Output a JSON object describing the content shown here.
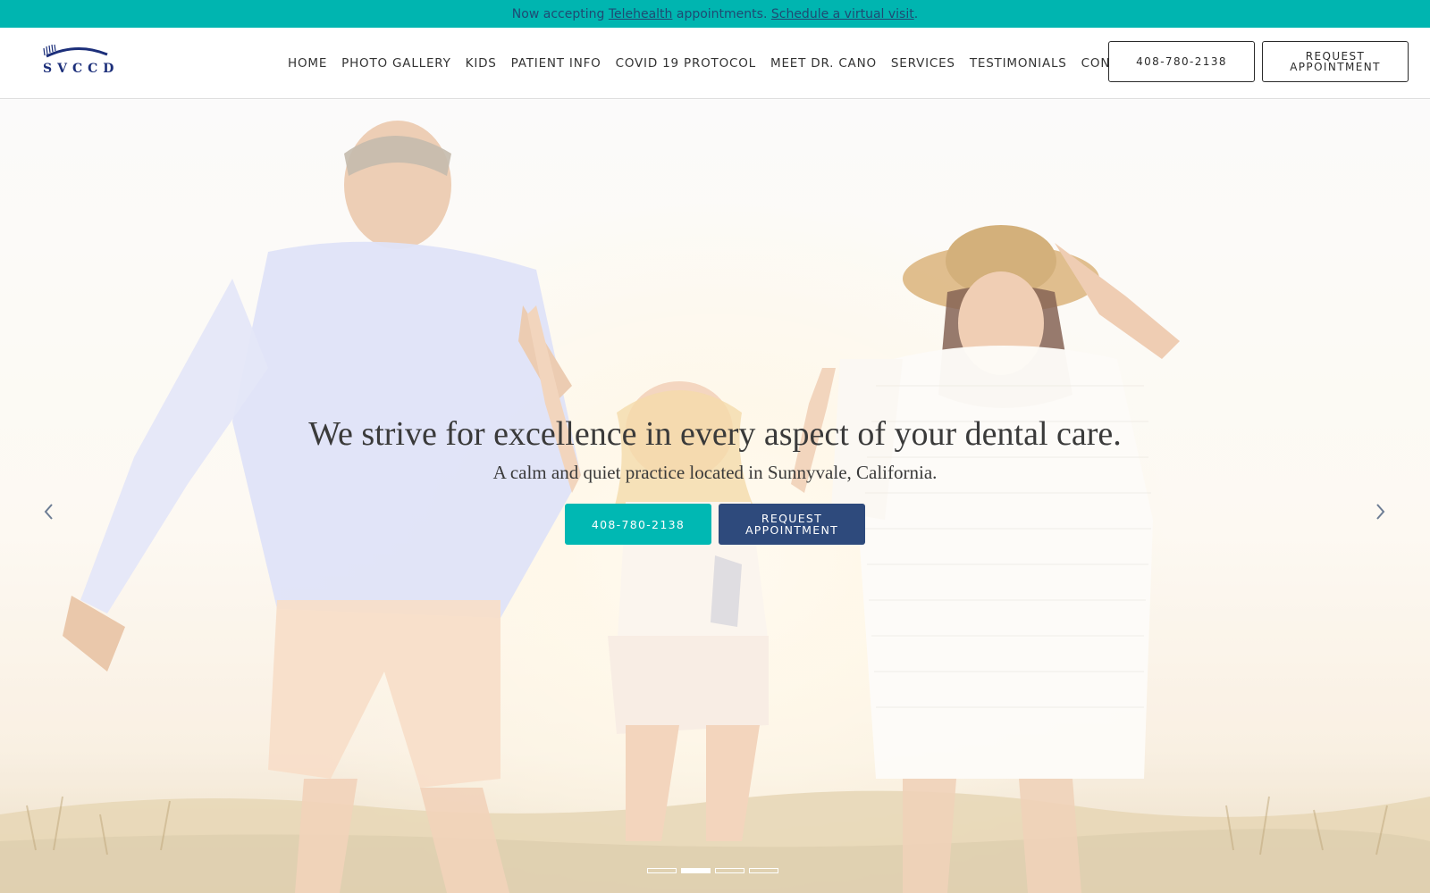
{
  "announcement": {
    "prefix": "Now accepting ",
    "telehealth_link": "Telehealth",
    "middle": " appointments. ",
    "schedule_link": "Schedule a virtual visit",
    "suffix": "."
  },
  "logo": {
    "text": "SVCCD",
    "icon": "toothbrush-arc-icon"
  },
  "nav": {
    "items": [
      {
        "label": "HOME"
      },
      {
        "label": "PHOTO GALLERY"
      },
      {
        "label": "KIDS"
      },
      {
        "label": "PATIENT INFO"
      },
      {
        "label": "COVID 19 PROTOCOL"
      },
      {
        "label": "MEET DR. CANO"
      },
      {
        "label": "SERVICES"
      },
      {
        "label": "TESTIMONIALS"
      },
      {
        "label": "CONTACT"
      }
    ]
  },
  "header_buttons": {
    "phone": "408-780-2138",
    "request_line1": "REQUEST",
    "request_line2": "APPOINTMENT"
  },
  "hero": {
    "headline": "We strive for excellence in every aspect of your dental care.",
    "subline": "A calm and quiet practice located in Sunnyvale, California.",
    "phone_button": "408-780-2138",
    "request_line1": "REQUEST",
    "request_line2": "APPOINTMENT",
    "prev_icon": "chevron-left-icon",
    "next_icon": "chevron-right-icon",
    "slides": {
      "count": 4,
      "active_index": 1
    }
  },
  "colors": {
    "accent_teal": "#00b5b0",
    "navy": "#2e4a7c",
    "logo_blue": "#1c2f7a"
  }
}
